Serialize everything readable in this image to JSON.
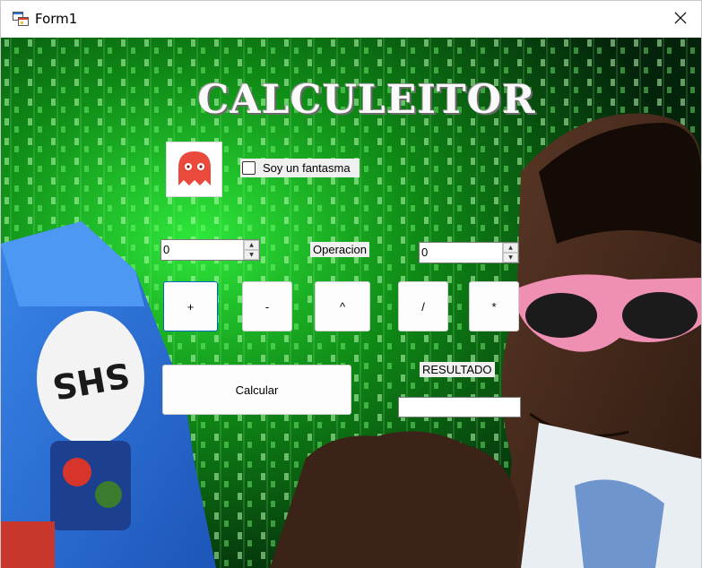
{
  "window": {
    "title": "Form1",
    "icons": {
      "app": "windows-form-icon",
      "close": "close-icon"
    }
  },
  "form": {
    "heading": "CALCULEITOR",
    "ghost_icon": "ghost-icon",
    "checkbox": {
      "label": "Soy un fantasma",
      "checked": false
    },
    "number1": {
      "value": "0"
    },
    "number2": {
      "value": "0"
    },
    "operation_label": "Operacion",
    "operators": [
      "+",
      "-",
      "^",
      "/",
      "*"
    ],
    "calculate_label": "Calcular",
    "result_label": "RESULTADO",
    "result_value": ""
  },
  "colors": {
    "matrix_green": "#19c81e",
    "ghost_red": "#e94a3c",
    "laptop_blue": "#2a6fd6",
    "focus_blue": "#0067c0"
  }
}
